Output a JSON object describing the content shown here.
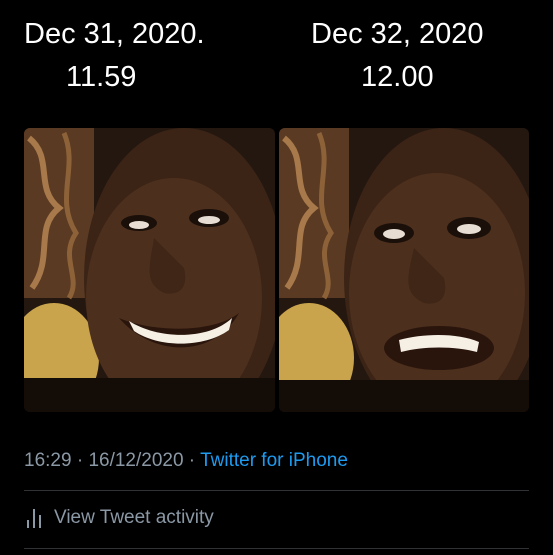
{
  "meme": {
    "left_caption": {
      "date": "Dec 31, 2020.",
      "time": "11.59"
    },
    "right_caption": {
      "date": "Dec 32, 2020",
      "time": "12.00"
    }
  },
  "tweet": {
    "time": "16:29",
    "separator": " · ",
    "date": "16/12/2020",
    "source": "Twitter for iPhone",
    "activity_label": "View Tweet activity",
    "activity_icon": "bar-chart-icon"
  },
  "colors": {
    "background": "#000000",
    "caption_text": "#ffffff",
    "meta_text": "#8b98a5",
    "link": "#1d9bf0",
    "divider": "#2f3336"
  }
}
